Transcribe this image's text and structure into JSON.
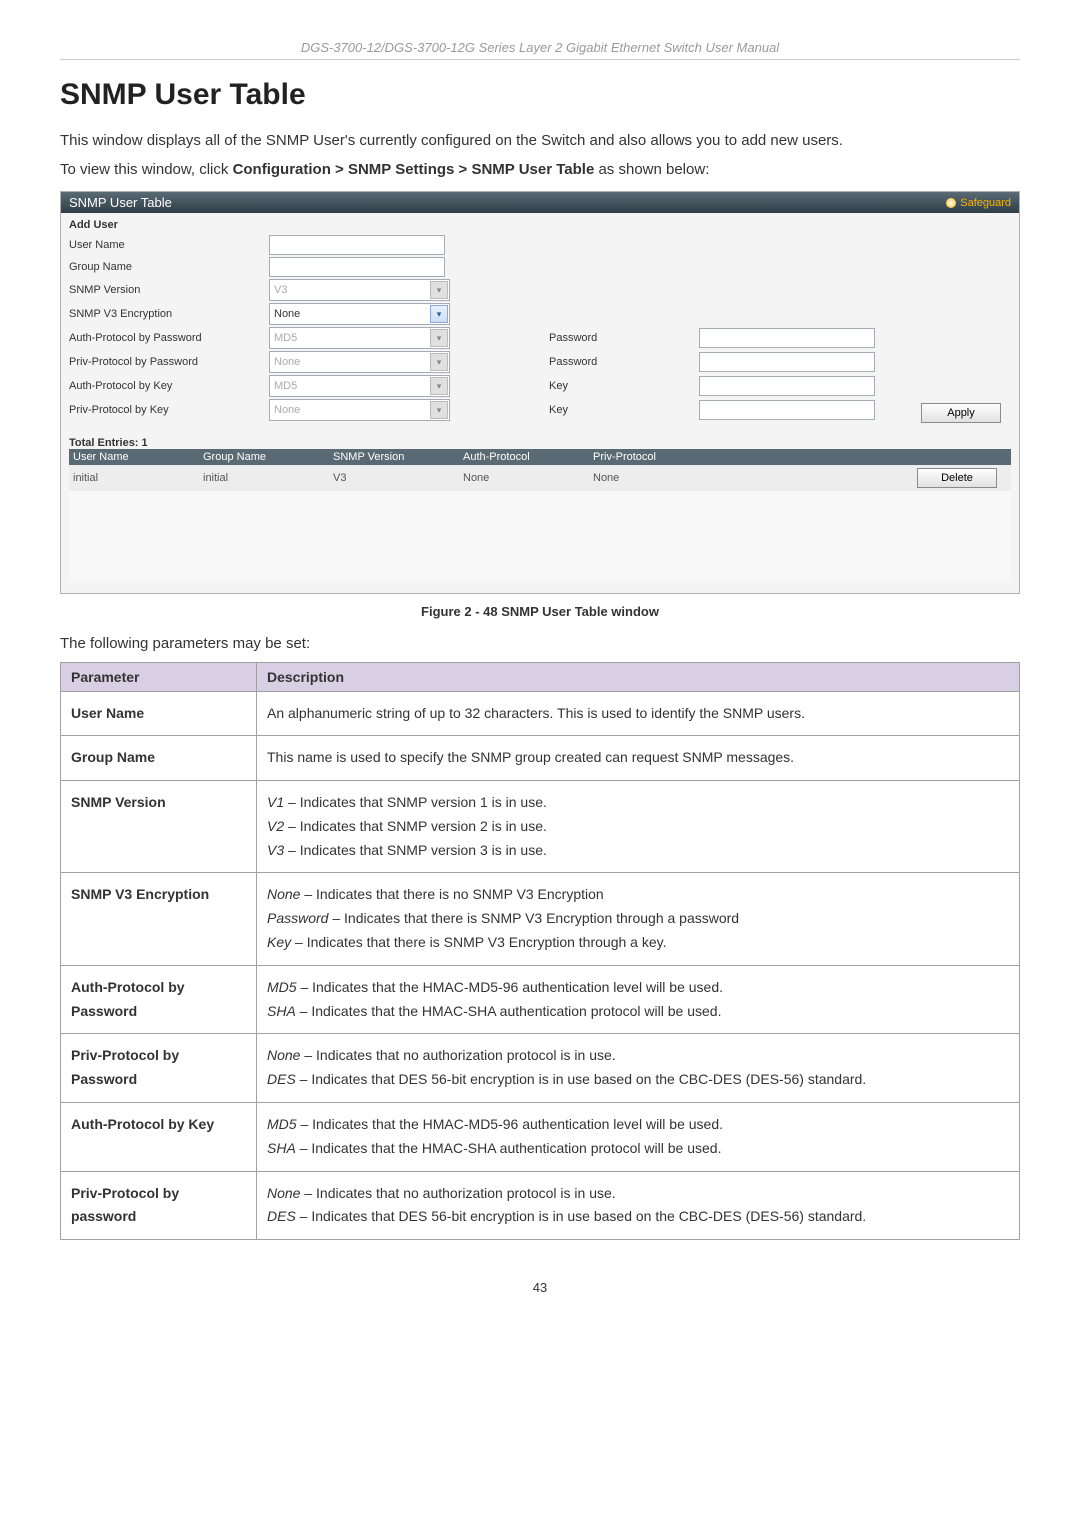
{
  "header": {
    "running_title": "DGS-3700-12/DGS-3700-12G Series Layer 2 Gigabit Ethernet Switch User Manual"
  },
  "title": "SNMP User Table",
  "intro_text_1": "This window displays all of the SNMP User's currently configured on the Switch and also allows you to add new users.",
  "intro_text_2_prefix": "To view this window, click ",
  "intro_text_2_bold": "Configuration > SNMP Settings > SNMP User Table",
  "intro_text_2_suffix": " as shown below:",
  "panel": {
    "title": "SNMP User Table",
    "safeguard_label": "Safeguard",
    "add_user_label": "Add User",
    "labels": {
      "user_name": "User Name",
      "group_name": "Group Name",
      "snmp_version": "SNMP Version",
      "snmp_v3_encryption": "SNMP V3 Encryption",
      "auth_protocol_by_password": "Auth-Protocol by Password",
      "priv_protocol_by_password": "Priv-Protocol by Password",
      "auth_protocol_by_key": "Auth-Protocol by Key",
      "priv_protocol_by_key": "Priv-Protocol by Key",
      "password": "Password",
      "key": "Key"
    },
    "values": {
      "snmp_version": "V3",
      "snmp_v3_encryption": "None",
      "auth_protocol_by_password": "MD5",
      "priv_protocol_by_password": "None",
      "auth_protocol_by_key": "MD5",
      "priv_protocol_by_key": "None"
    },
    "apply_label": "Apply",
    "total_entries_label": "Total Entries: 1",
    "table_headers": {
      "user_name": "User Name",
      "group_name": "Group Name",
      "snmp_version": "SNMP Version",
      "auth_protocol": "Auth-Protocol",
      "priv_protocol": "Priv-Protocol"
    },
    "rows": [
      {
        "user_name": "initial",
        "group_name": "initial",
        "snmp_version": "V3",
        "auth_protocol": "None",
        "priv_protocol": "None"
      }
    ],
    "delete_label": "Delete"
  },
  "figure_caption": "Figure 2 - 48 SNMP User Table window",
  "params_intro": "The following parameters may be set:",
  "param_table": {
    "headers": {
      "param": "Parameter",
      "desc": "Description"
    },
    "rows": {
      "user_name": {
        "param": "User Name",
        "desc": "An alphanumeric string of up to 32 characters. This is used to identify the SNMP users."
      },
      "group_name": {
        "param": "Group Name",
        "desc": "This name is used to specify the SNMP group created can request SNMP messages."
      },
      "snmp_version": {
        "param": "SNMP Version",
        "lines": [
          {
            "opt": "V1",
            "rest": " – Indicates that SNMP version 1 is in use."
          },
          {
            "opt": "V2",
            "rest": " – Indicates that SNMP version 2 is in use."
          },
          {
            "opt": "V3",
            "rest": " – Indicates that SNMP version 3 is in use."
          }
        ]
      },
      "snmp_v3_encryption": {
        "param": "SNMP V3 Encryption",
        "lines": [
          {
            "opt": "None",
            "rest": " – Indicates that there is no SNMP V3 Encryption"
          },
          {
            "opt": "Password",
            "rest": " – Indicates that there is SNMP V3 Encryption through a password"
          },
          {
            "opt": "Key",
            "rest": " – Indicates that there is SNMP V3 Encryption through a key."
          }
        ]
      },
      "auth_protocol_by_password": {
        "param": "Auth-Protocol by Password",
        "lines": [
          {
            "opt": "MD5",
            "rest": " – Indicates that the HMAC-MD5-96 authentication level will be used."
          },
          {
            "opt": "SHA",
            "rest": " – Indicates that the HMAC-SHA authentication protocol will be used."
          }
        ]
      },
      "priv_protocol_by_password": {
        "param": "Priv-Protocol by Password",
        "lines": [
          {
            "opt": "None",
            "rest": " – Indicates that no authorization protocol is in use."
          },
          {
            "opt": "DES",
            "rest": " – Indicates that DES 56-bit encryption is in use based on the CBC-DES (DES-56) standard."
          }
        ]
      },
      "auth_protocol_by_key": {
        "param": "Auth-Protocol by Key",
        "lines": [
          {
            "opt": "MD5",
            "rest": " – Indicates that the HMAC-MD5-96 authentication level will be used."
          },
          {
            "opt": "SHA",
            "rest": " – Indicates that the HMAC-SHA authentication protocol will be used."
          }
        ]
      },
      "priv_protocol_by_password2": {
        "param": "Priv-Protocol by password",
        "lines": [
          {
            "opt": "None",
            "rest": " – Indicates that no authorization protocol is in use."
          },
          {
            "opt": "DES",
            "rest": " – Indicates that DES 56-bit encryption is in use based on the CBC-DES (DES-56) standard."
          }
        ]
      }
    }
  },
  "page_number": "43"
}
